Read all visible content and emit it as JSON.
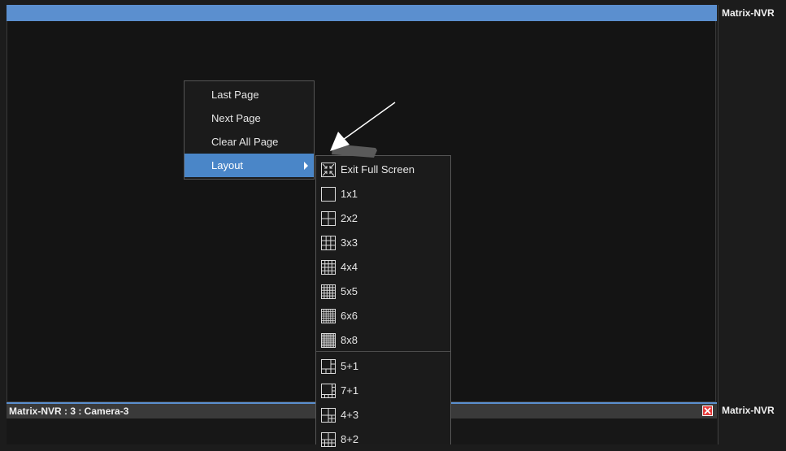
{
  "right_panel": {
    "top_label": "Matrix-NVR",
    "bottom_label": "Matrix-NVR"
  },
  "bottom_pane": {
    "title": "Matrix-NVR : 3 : Camera-3"
  },
  "context_menu": {
    "items": [
      {
        "label": "Last Page"
      },
      {
        "label": "Next Page"
      },
      {
        "label": "Clear All Page"
      },
      {
        "label": "Layout",
        "has_submenu": true,
        "active": true
      }
    ]
  },
  "layout_submenu": {
    "items": [
      {
        "label": "Exit Full Screen",
        "icon": "exit-fullscreen-icon"
      },
      {
        "label": "1x1",
        "icon": "layout-1x1-icon"
      },
      {
        "label": "2x2",
        "icon": "layout-2x2-icon"
      },
      {
        "label": "3x3",
        "icon": "layout-3x3-icon"
      },
      {
        "label": "4x4",
        "icon": "layout-4x4-icon"
      },
      {
        "label": "5x5",
        "icon": "layout-5x5-icon"
      },
      {
        "label": "6x6",
        "icon": "layout-6x6-icon"
      },
      {
        "label": "8x8",
        "icon": "layout-8x8-icon"
      },
      {
        "label": "5+1",
        "icon": "layout-5plus1-icon"
      },
      {
        "label": "7+1",
        "icon": "layout-7plus1-icon"
      },
      {
        "label": "4+3",
        "icon": "layout-4plus3-icon"
      },
      {
        "label": "8+2",
        "icon": "layout-8plus2-icon"
      }
    ]
  },
  "colors": {
    "accent": "#4a86c8",
    "titlebar": "#5b8fcf",
    "close": "#e53a3a"
  }
}
